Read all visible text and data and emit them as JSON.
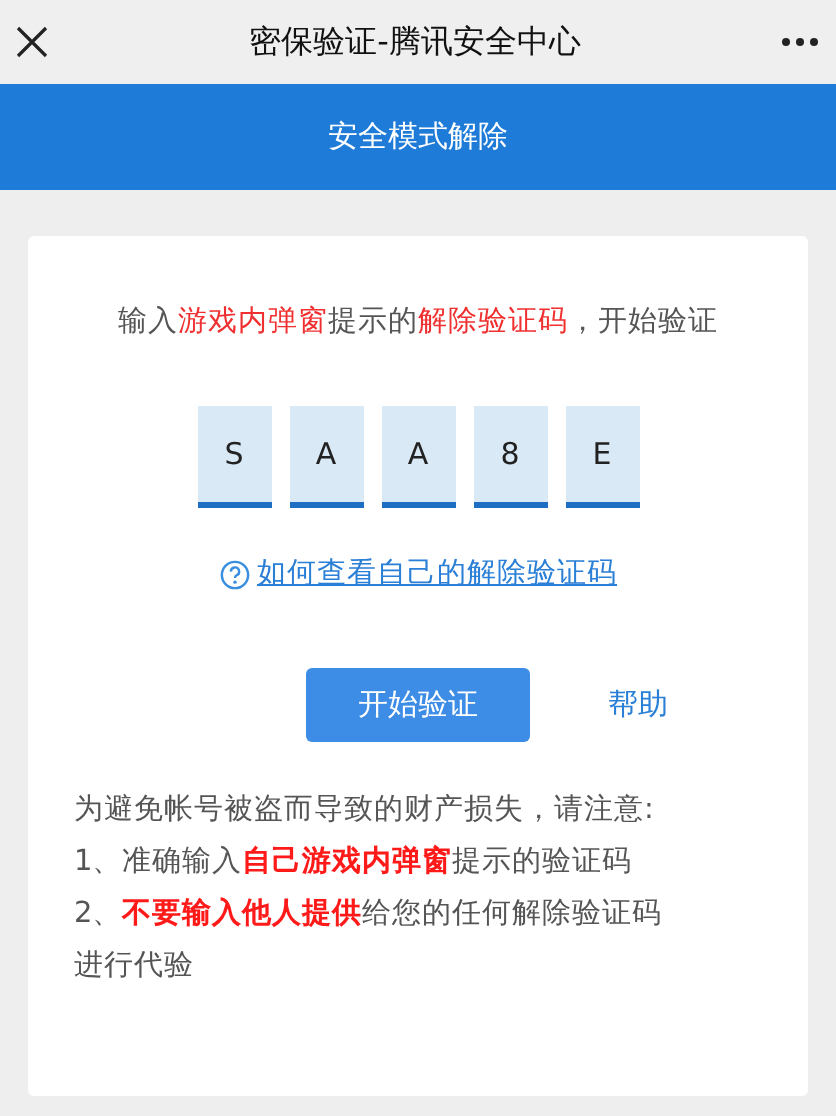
{
  "window": {
    "title": "密保验证-腾讯安全中心"
  },
  "banner": {
    "title": "安全模式解除"
  },
  "instruction": [
    {
      "text": "输入",
      "highlight": false
    },
    {
      "text": "游戏内弹窗",
      "highlight": true
    },
    {
      "text": "提示的",
      "highlight": false
    },
    {
      "text": "解除验证码",
      "highlight": true
    },
    {
      "text": "，开始验证",
      "highlight": false
    }
  ],
  "code_chars": [
    "S",
    "A",
    "A",
    "8",
    "E"
  ],
  "help_link": "如何查看自己的解除验证码",
  "buttons": {
    "primary": "开始验证",
    "secondary": "帮助"
  },
  "notes": [
    [
      {
        "text": "为避免帐号被盗而导致的财产损失，请注意:",
        "highlight": false
      }
    ],
    [
      {
        "text": "1、准确输入",
        "highlight": false
      },
      {
        "text": "自己游戏内弹窗",
        "highlight": true
      },
      {
        "text": "提示的验证码",
        "highlight": false
      }
    ],
    [
      {
        "text": "2、",
        "highlight": false
      },
      {
        "text": "不要输入他人提供",
        "highlight": true
      },
      {
        "text": "给您的任何解除验证码",
        "highlight": false
      }
    ],
    [
      {
        "text": "进行代验",
        "highlight": false
      }
    ]
  ]
}
